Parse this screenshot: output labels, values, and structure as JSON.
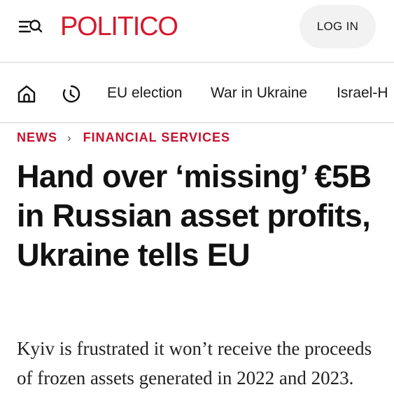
{
  "header": {
    "logo": "POLITICO",
    "login_label": "LOG IN"
  },
  "nav": {
    "items": [
      {
        "label": "EU election"
      },
      {
        "label": "War in Ukraine"
      },
      {
        "label": "Israel-H"
      }
    ]
  },
  "breadcrumb": {
    "section": "NEWS",
    "separator": "›",
    "subsection": "FINANCIAL SERVICES"
  },
  "article": {
    "headline": "Hand over ‘missing’ €5B in Russian asset profits, Ukraine tells EU",
    "dek": "Kyiv is frustrated it won’t receive the proceeds of frozen assets generated in 2022 and 2023."
  },
  "colors": {
    "brand": "#d7192d",
    "section": "#c8102e",
    "button_bg": "#f2f2f2",
    "divider": "#e6e6e6"
  },
  "icons": [
    "menu-search-icon",
    "home-icon",
    "recent-clock-icon",
    "breadcrumb-chevron-icon"
  ]
}
